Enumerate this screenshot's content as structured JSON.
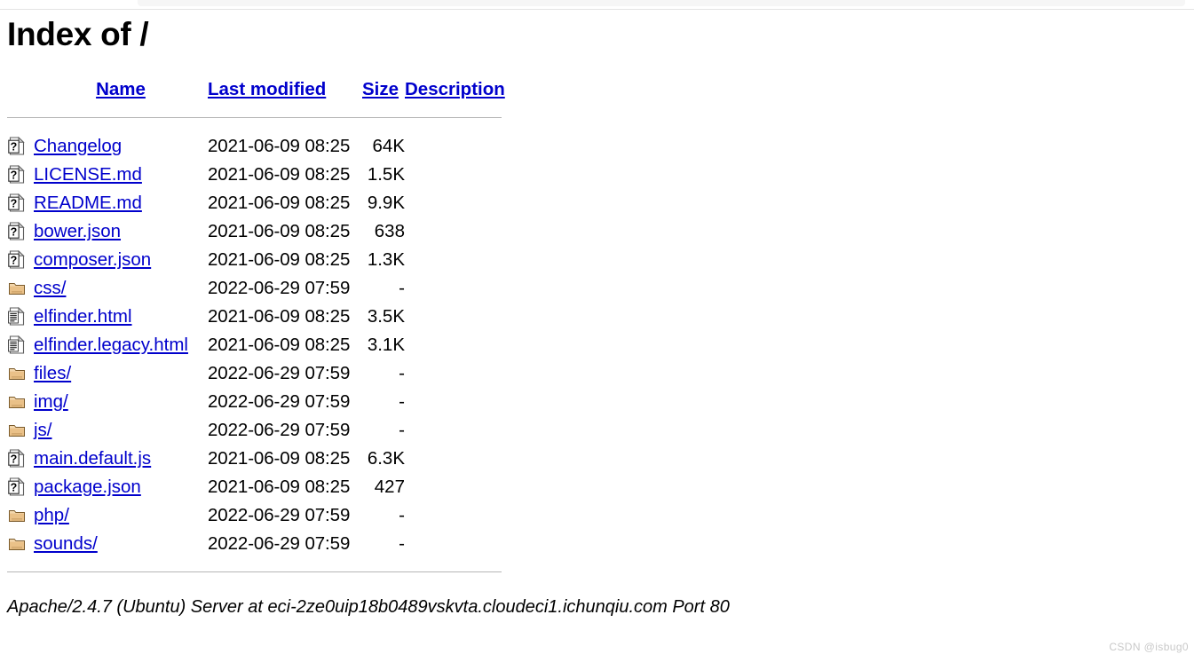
{
  "browser": {
    "chrome_visible": true
  },
  "page": {
    "title": "Index of /"
  },
  "table": {
    "headers": {
      "icon": "",
      "name": "Name",
      "last_modified": "Last modified",
      "size": "Size",
      "description": "Description"
    },
    "rows": [
      {
        "icon": "unknown-file-icon",
        "name": "Changelog",
        "last_modified": "2021-06-09 08:25",
        "size": "64K",
        "description": ""
      },
      {
        "icon": "unknown-file-icon",
        "name": "LICENSE.md",
        "last_modified": "2021-06-09 08:25",
        "size": "1.5K",
        "description": ""
      },
      {
        "icon": "unknown-file-icon",
        "name": "README.md",
        "last_modified": "2021-06-09 08:25",
        "size": "9.9K",
        "description": ""
      },
      {
        "icon": "unknown-file-icon",
        "name": "bower.json",
        "last_modified": "2021-06-09 08:25",
        "size": "638",
        "description": ""
      },
      {
        "icon": "unknown-file-icon",
        "name": "composer.json",
        "last_modified": "2021-06-09 08:25",
        "size": "1.3K",
        "description": ""
      },
      {
        "icon": "folder-icon",
        "name": "css/",
        "last_modified": "2022-06-29 07:59",
        "size": "-",
        "description": ""
      },
      {
        "icon": "text-file-icon",
        "name": "elfinder.html",
        "last_modified": "2021-06-09 08:25",
        "size": "3.5K",
        "description": ""
      },
      {
        "icon": "text-file-icon",
        "name": "elfinder.legacy.html",
        "last_modified": "2021-06-09 08:25",
        "size": "3.1K",
        "description": ""
      },
      {
        "icon": "folder-icon",
        "name": "files/",
        "last_modified": "2022-06-29 07:59",
        "size": "-",
        "description": ""
      },
      {
        "icon": "folder-icon",
        "name": "img/",
        "last_modified": "2022-06-29 07:59",
        "size": "-",
        "description": ""
      },
      {
        "icon": "folder-icon",
        "name": "js/",
        "last_modified": "2022-06-29 07:59",
        "size": "-",
        "description": ""
      },
      {
        "icon": "unknown-file-icon",
        "name": "main.default.js",
        "last_modified": "2021-06-09 08:25",
        "size": "6.3K",
        "description": ""
      },
      {
        "icon": "unknown-file-icon",
        "name": "package.json",
        "last_modified": "2021-06-09 08:25",
        "size": "427",
        "description": ""
      },
      {
        "icon": "folder-icon",
        "name": "php/",
        "last_modified": "2022-06-29 07:59",
        "size": "-",
        "description": ""
      },
      {
        "icon": "folder-icon",
        "name": "sounds/",
        "last_modified": "2022-06-29 07:59",
        "size": "-",
        "description": ""
      }
    ]
  },
  "footer": {
    "server_signature": "Apache/2.4.7 (Ubuntu) Server at eci-2ze0uip18b0489vskvta.cloudeci1.ichunqiu.com Port 80"
  },
  "watermark": {
    "text": "CSDN @isbug0"
  },
  "colors": {
    "link": "#0000cc",
    "text": "#000000",
    "rule": "#b5b5b5",
    "folder_fill": "#eac188",
    "folder_edge": "#7a5a2a",
    "watermark": "#c9c9c9",
    "background": "#ffffff"
  }
}
